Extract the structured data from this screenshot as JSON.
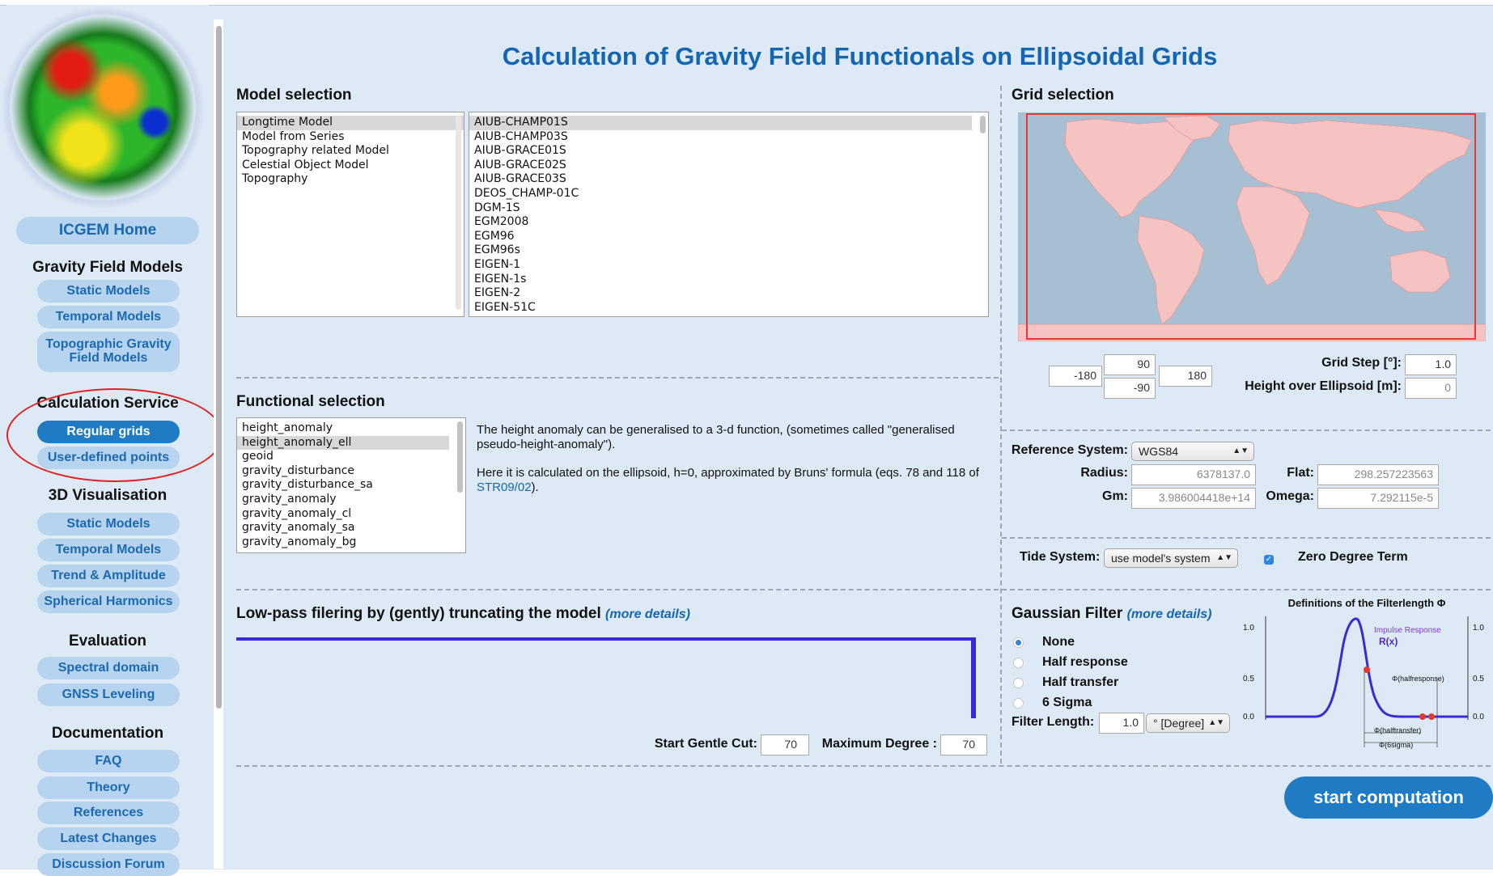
{
  "title": "Calculation of Gravity Field Functionals on Ellipsoidal Grids",
  "sidebar": {
    "home": "ICGEM Home",
    "sections": [
      {
        "title": "Gravity Field Models",
        "items": [
          "Static Models",
          "Temporal Models",
          "Topographic Gravity Field Models"
        ]
      },
      {
        "title": "Calculation Service",
        "items": [
          "Regular grids",
          "User-defined points"
        ]
      },
      {
        "title": "3D Visualisation",
        "items": [
          "Static Models",
          "Temporal Models",
          "Trend & Amplitude",
          "Spherical Harmonics"
        ]
      },
      {
        "title": "Evaluation",
        "items": [
          "Spectral domain",
          "GNSS Leveling"
        ]
      },
      {
        "title": "Documentation",
        "items": [
          "FAQ",
          "Theory",
          "References",
          "Latest Changes",
          "Discussion Forum"
        ]
      }
    ],
    "active_item": "Regular grids"
  },
  "model_selection": {
    "header": "Model selection",
    "categories": [
      "Longtime Model",
      "Model from Series",
      "Topography related Model",
      "Celestial Object Model",
      "Topography"
    ],
    "selected_category": "Longtime Model",
    "models": [
      "AIUB-CHAMP01S",
      "AIUB-CHAMP03S",
      "AIUB-GRACE01S",
      "AIUB-GRACE02S",
      "AIUB-GRACE03S",
      "DEOS_CHAMP-01C",
      "DGM-1S",
      "EGM2008",
      "EGM96",
      "EGM96s",
      "EIGEN-1",
      "EIGEN-1s",
      "EIGEN-2",
      "EIGEN-51C"
    ],
    "selected_model": "AIUB-CHAMP01S"
  },
  "grid_selection": {
    "header": "Grid selection",
    "west": "-180",
    "north": "90",
    "south": "-90",
    "east": "180",
    "grid_step_label": "Grid Step [°]:",
    "grid_step": "1.0",
    "height_label": "Height over Ellipsoid [m]:",
    "height": "0",
    "land_color": "#f6c3c3",
    "ocean_color": "#a7bfd3",
    "box_color": "#e53939"
  },
  "functional_selection": {
    "header": "Functional selection",
    "items": [
      "height_anomaly",
      "height_anomaly_ell",
      "geoid",
      "gravity_disturbance",
      "gravity_disturbance_sa",
      "gravity_anomaly",
      "gravity_anomaly_cl",
      "gravity_anomaly_sa",
      "gravity_anomaly_bg"
    ],
    "selected": "height_anomaly_ell",
    "description_1": "The height anomaly can be generalised to a 3-d function, (sometimes called \"generalised pseudo-height-anomaly\").",
    "description_2a": "Here it is calculated on the ellipsoid, h=0, approximated by Bruns' formula (eqs. 78 and 118 of ",
    "description_link": "STR09/02",
    "description_2b": ")."
  },
  "reference": {
    "system_label": "Reference System:",
    "system": "WGS84",
    "radius_label": "Radius:",
    "radius": "6378137.0",
    "flat_label": "Flat:",
    "flat": "298.257223563",
    "gm_label": "Gm:",
    "gm": "3.986004418e+14",
    "omega_label": "Omega:",
    "omega": "7.292115e-5"
  },
  "tide": {
    "label": "Tide System:",
    "value": "use model's system",
    "zero_degree_label": "Zero Degree Term",
    "zero_degree_checked": true
  },
  "lowpass": {
    "header": "Low-pass filering by (gently) truncating the model",
    "more": "(more details)",
    "start_cut_label": "Start Gentle Cut:",
    "start_cut": "70",
    "max_degree_label": "Maximum Degree :",
    "max_degree": "70",
    "line_color": "#3a2ad4"
  },
  "gaussian": {
    "header": "Gaussian Filter",
    "more": "(more details)",
    "options": [
      "None",
      "Half response",
      "Half transfer",
      "6 Sigma"
    ],
    "selected": "None",
    "filter_length_label": "Filter Length:",
    "filter_length": "1.0",
    "unit": "° [Degree]",
    "figure": {
      "title": "Definitions of the Filterlength Φ",
      "y_ticks": [
        "1.0",
        "0.5",
        "0.0"
      ],
      "curve_label_1": "Impulse Response",
      "curve_label_2": "R(x)",
      "marks": [
        "Φ(halfresponse)",
        "Φ(halftransfer)",
        "Φ(6sigma)"
      ]
    }
  },
  "start_button": "start computation"
}
